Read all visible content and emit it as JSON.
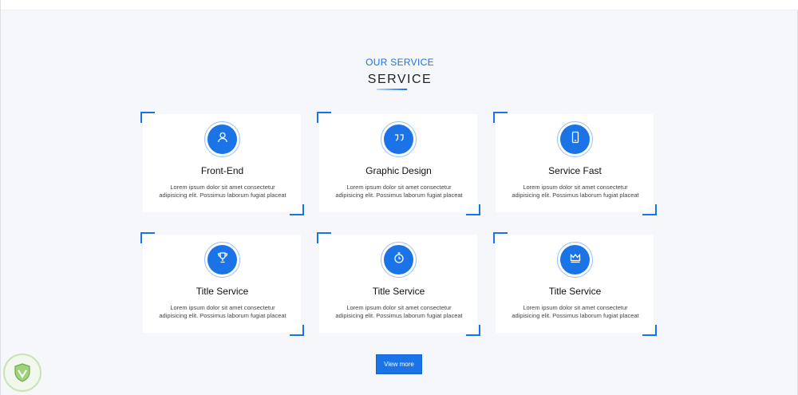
{
  "section": {
    "eyebrow": "OUR SERVICE",
    "title": "SERVICE"
  },
  "cards": [
    {
      "title": "Front-End",
      "text": "Lorem ipsum dolor sit amet consectetur adipisicing elit. Possimus laborum fugiat placeat eum, ver",
      "icon": "user-icon"
    },
    {
      "title": "Graphic Design",
      "text": "Lorem ipsum dolor sit amet consectetur adipisicing elit. Possimus laborum fugiat placeat eum,...",
      "icon": "quote-icon"
    },
    {
      "title": "Service Fast",
      "text": "Lorem ipsum dolor sit amet consectetur adipisicing elit. Possimus laborum fugiat placeat eum, ver",
      "icon": "mobile-icon"
    },
    {
      "title": "Title Service",
      "text": "Lorem ipsum dolor sit amet consectetur adipisicing elit. Possimus laborum fugiat placeat eum, ver",
      "icon": "trophy-icon"
    },
    {
      "title": "Title Service",
      "text": "Lorem ipsum dolor sit amet consectetur adipisicing elit. Possimus laborum fugiat placeat eum, ver",
      "icon": "stopwatch-icon"
    },
    {
      "title": "Title Service",
      "text": "Lorem ipsum dolor sit amet consectetur adipisicing elit. Possimus laborum fugiat placeat eum, ver",
      "icon": "crown-icon"
    }
  ],
  "button": {
    "label": "View more"
  },
  "colors": {
    "accent": "#1a74e8",
    "background": "#f5f7fa",
    "card": "#ffffff"
  }
}
